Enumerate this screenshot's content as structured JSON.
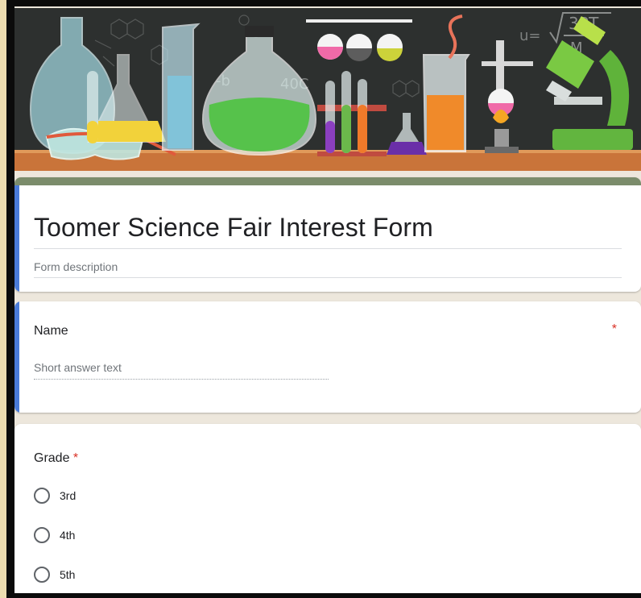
{
  "form": {
    "title": "Toomer Science Fair Interest Form",
    "description_placeholder": "Form description",
    "accent_color": "#4a7bd8",
    "theme_color": "#7b8c6b"
  },
  "questions": [
    {
      "label": "Name",
      "required_marker": "*",
      "type": "short-answer",
      "placeholder": "Short answer text"
    },
    {
      "label": "Grade",
      "required_marker": "*",
      "type": "multiple-choice",
      "options": [
        "3rd",
        "4th",
        "5th"
      ]
    }
  ],
  "header_image": {
    "icons": [
      "flask-icon",
      "beaker-icon",
      "test-tube-icon",
      "goggles-icon",
      "microscope-icon",
      "bunsen-burner-icon"
    ],
    "chalkboard_text": [
      "-b",
      "40C",
      "u=",
      "3RT",
      "M"
    ]
  }
}
